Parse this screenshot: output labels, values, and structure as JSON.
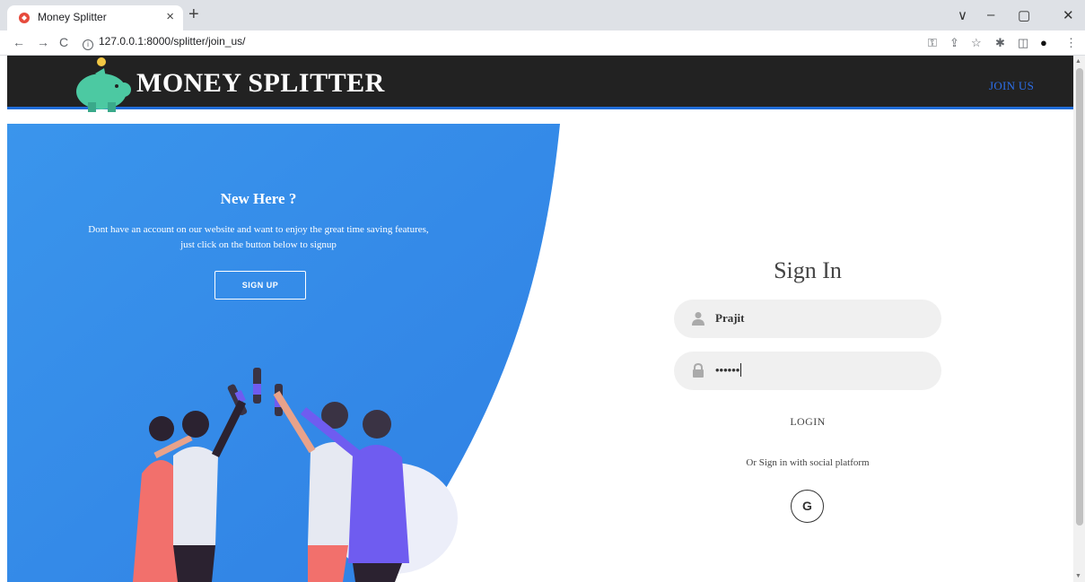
{
  "browser": {
    "tab_title": "Money Splitter",
    "tab_close": "×",
    "new_tab": "+",
    "url": "127.0.0.1:8000/splitter/join_us/",
    "controls": {
      "chevron": "∨",
      "minimize": "–",
      "maximize": "▢",
      "close": "✕"
    },
    "nav": {
      "back": "←",
      "forward": "→",
      "reload": "C"
    },
    "toolbar_icons": [
      "key-icon",
      "share-icon",
      "star-icon",
      "extensions-icon",
      "sidepanel-icon",
      "profile-icon",
      "menu-icon"
    ]
  },
  "header": {
    "brand": "MONEY SPLITTER",
    "join_link": "JOIN US"
  },
  "left_panel": {
    "title": "New Here ?",
    "text_line1": "Dont have an account on our website and want to enjoy the great time saving features,",
    "text_line2": "just click on the button below to signup",
    "signup_label": "SIGN UP"
  },
  "signin": {
    "title": "Sign In",
    "username_value": "Prajit",
    "password_value": "••••••",
    "login_label": "LOGIN",
    "social_text": "Or Sign in with social platform",
    "google_label": "G"
  },
  "colors": {
    "accent": "#2d6ee8",
    "panel": "#3590ec",
    "header": "#222222"
  }
}
